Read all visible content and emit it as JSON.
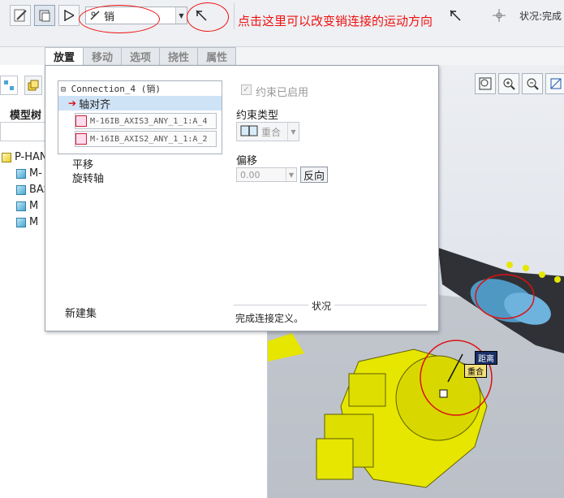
{
  "toolbar": {
    "connection_type": "销",
    "annotation": "点击这里可以改变销连接的运动方向",
    "status_label": "状况:完成"
  },
  "tabs": [
    "放置",
    "移动",
    "选项",
    "挠性",
    "属性"
  ],
  "left_panel": {
    "tree_title": "模型树",
    "items": [
      "P-HAN",
      "M-",
      "BAS",
      "M",
      "M"
    ]
  },
  "placement": {
    "connection": "Connection_4 (销)",
    "selected_constraint": "轴对齐",
    "references": [
      "M-16IB_AXIS3_ANY_1_1:A_4",
      "M-16IB_AXIS2_ANY_1_1:A_2"
    ],
    "other_constraints": [
      "平移",
      "旋转轴"
    ],
    "new_set": "新建集",
    "constraint_enabled": "约束已启用",
    "constraint_type_label": "约束类型",
    "constraint_type_value": "重合",
    "offset_label": "偏移",
    "offset_value": "0.00",
    "flip_button": "反向",
    "status_title": "状况",
    "status_text": "完成连接定义。"
  },
  "viewport_labels": {
    "distance": "距离",
    "coincident": "重合"
  },
  "colors": {
    "annotation_red": "#e11111",
    "selection_blue": "#cfe3f7",
    "part_yellow": "#e6e600"
  }
}
